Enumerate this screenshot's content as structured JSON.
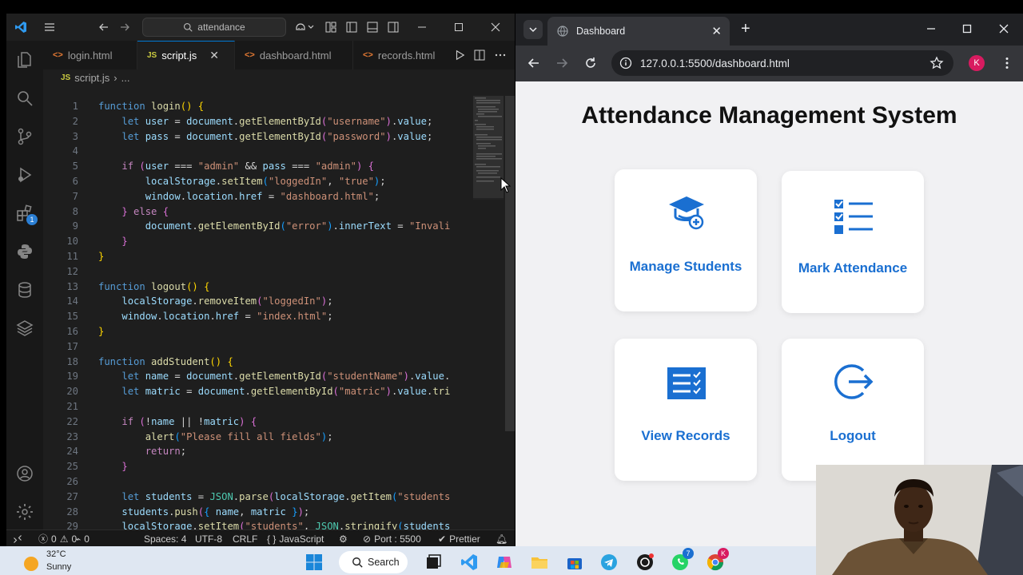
{
  "vscode": {
    "search_text": "attendance",
    "tabs": [
      {
        "label": "login.html",
        "type": "html",
        "active": false
      },
      {
        "label": "script.js",
        "type": "js",
        "active": true
      },
      {
        "label": "dashboard.html",
        "type": "html",
        "active": false
      },
      {
        "label": "records.html",
        "type": "html",
        "active": false
      }
    ],
    "breadcrumb": {
      "file": "script.js",
      "rest": "..."
    },
    "activity_badge": "1",
    "code_lines": [
      {
        "n": "1",
        "html": "<span class='kw'>function</span> <span class='fn'>login</span><span class='br1'>()</span> <span class='br1'>{</span>"
      },
      {
        "n": "2",
        "html": "    <span class='kw'>let</span> <span class='var'>user</span> = <span class='var'>document</span>.<span class='fn'>getElementById</span><span class='br2'>(</span><span class='str'>\"username\"</span><span class='br2'>)</span>.<span class='var'>value</span>;"
      },
      {
        "n": "3",
        "html": "    <span class='kw'>let</span> <span class='var'>pass</span> = <span class='var'>document</span>.<span class='fn'>getElementById</span><span class='br2'>(</span><span class='str'>\"password\"</span><span class='br2'>)</span>.<span class='var'>value</span>;"
      },
      {
        "n": "4",
        "html": ""
      },
      {
        "n": "5",
        "html": "    <span class='ctl'>if</span> <span class='br2'>(</span><span class='var'>user</span> === <span class='str'>\"admin\"</span> &amp;&amp; <span class='var'>pass</span> === <span class='str'>\"admin\"</span><span class='br2'>)</span> <span class='br2'>{</span>"
      },
      {
        "n": "6",
        "html": "        <span class='var'>localStorage</span>.<span class='fn'>setItem</span><span class='br3'>(</span><span class='str'>\"loggedIn\"</span>, <span class='str'>\"true\"</span><span class='br3'>)</span>;"
      },
      {
        "n": "7",
        "html": "        <span class='var'>window</span>.<span class='var'>location</span>.<span class='var'>href</span> = <span class='str'>\"dashboard.html\"</span>;"
      },
      {
        "n": "8",
        "html": "    <span class='br2'>}</span> <span class='ctl'>else</span> <span class='br2'>{</span>"
      },
      {
        "n": "9",
        "html": "        <span class='var'>document</span>.<span class='fn'>getElementById</span><span class='br3'>(</span><span class='str'>\"error\"</span><span class='br3'>)</span>.<span class='var'>innerText</span> = <span class='str'>\"Invali</span>"
      },
      {
        "n": "10",
        "html": "    <span class='br2'>}</span>"
      },
      {
        "n": "11",
        "html": "<span class='br1'>}</span>"
      },
      {
        "n": "12",
        "html": ""
      },
      {
        "n": "13",
        "html": "<span class='kw'>function</span> <span class='fn'>logout</span><span class='br1'>()</span> <span class='br1'>{</span>"
      },
      {
        "n": "14",
        "html": "    <span class='var'>localStorage</span>.<span class='fn'>removeItem</span><span class='br2'>(</span><span class='str'>\"loggedIn\"</span><span class='br2'>)</span>;"
      },
      {
        "n": "15",
        "html": "    <span class='var'>window</span>.<span class='var'>location</span>.<span class='var'>href</span> = <span class='str'>\"index.html\"</span>;"
      },
      {
        "n": "16",
        "html": "<span class='br1'>}</span>"
      },
      {
        "n": "17",
        "html": ""
      },
      {
        "n": "18",
        "html": "<span class='kw'>function</span> <span class='fn'>addStudent</span><span class='br1'>()</span> <span class='br1'>{</span>"
      },
      {
        "n": "19",
        "html": "    <span class='kw'>let</span> <span class='var'>name</span> = <span class='var'>document</span>.<span class='fn'>getElementById</span><span class='br2'>(</span><span class='str'>\"studentName\"</span><span class='br2'>)</span>.<span class='var'>value</span>."
      },
      {
        "n": "20",
        "html": "    <span class='kw'>let</span> <span class='var'>matric</span> = <span class='var'>document</span>.<span class='fn'>getElementById</span><span class='br2'>(</span><span class='str'>\"matric\"</span><span class='br2'>)</span>.<span class='var'>value</span>.<span class='fn'>tri</span>"
      },
      {
        "n": "21",
        "html": ""
      },
      {
        "n": "22",
        "html": "    <span class='ctl'>if</span> <span class='br2'>(</span>!<span class='var'>name</span> || !<span class='var'>matric</span><span class='br2'>)</span> <span class='br2'>{</span>"
      },
      {
        "n": "23",
        "html": "        <span class='fn'>alert</span><span class='br3'>(</span><span class='str'>\"Please fill all fields\"</span><span class='br3'>)</span>;"
      },
      {
        "n": "24",
        "html": "        <span class='ctl'>return</span>;"
      },
      {
        "n": "25",
        "html": "    <span class='br2'>}</span>"
      },
      {
        "n": "26",
        "html": ""
      },
      {
        "n": "27",
        "html": "    <span class='kw'>let</span> <span class='var'>students</span> = <span class='obj'>JSON</span>.<span class='fn'>parse</span><span class='br2'>(</span><span class='var'>localStorage</span>.<span class='fn'>getItem</span><span class='br3'>(</span><span class='str'>\"students</span>"
      },
      {
        "n": "28",
        "html": "    <span class='var'>students</span>.<span class='fn'>push</span><span class='br2'>(</span><span class='br3'>{</span> <span class='var'>name</span>, <span class='var'>matric</span> <span class='br3'>}</span><span class='br2'>)</span>;"
      },
      {
        "n": "29",
        "html": "    <span class='var'>localStorage</span>.<span class='fn'>setItem</span><span class='br2'>(</span><span class='str'>\"students\"</span>, <span class='obj'>JSON</span>.<span class='fn'>stringify</span><span class='br3'>(</span><span class='var'>students</span>"
      }
    ],
    "status": {
      "errors": "0",
      "warnings": "0",
      "ports": "0",
      "spaces": "Spaces: 4",
      "encoding": "UTF-8",
      "eol": "CRLF",
      "language": "JavaScript",
      "port": "Port : 5500",
      "prettier": "Prettier"
    }
  },
  "chrome": {
    "tab_title": "Dashboard",
    "url": "127.0.0.1:5500/dashboard.html",
    "avatar": "K"
  },
  "page": {
    "title": "Attendance Management System",
    "cards": [
      {
        "label": "Manage Students",
        "icon": "graduation-cap-add-icon"
      },
      {
        "label": "Mark Attendance",
        "icon": "checklist-icon"
      },
      {
        "label": "View Records",
        "icon": "records-list-icon"
      },
      {
        "label": "Logout",
        "icon": "logout-icon"
      }
    ]
  },
  "taskbar": {
    "temp": "32°C",
    "weather": "Sunny",
    "search_label": "Search",
    "whatsapp_badge": "7"
  },
  "colors": {
    "accent_blue": "#1a6fd1",
    "vscode_bg": "#1e1e1e",
    "chrome_dark": "#35363a"
  }
}
